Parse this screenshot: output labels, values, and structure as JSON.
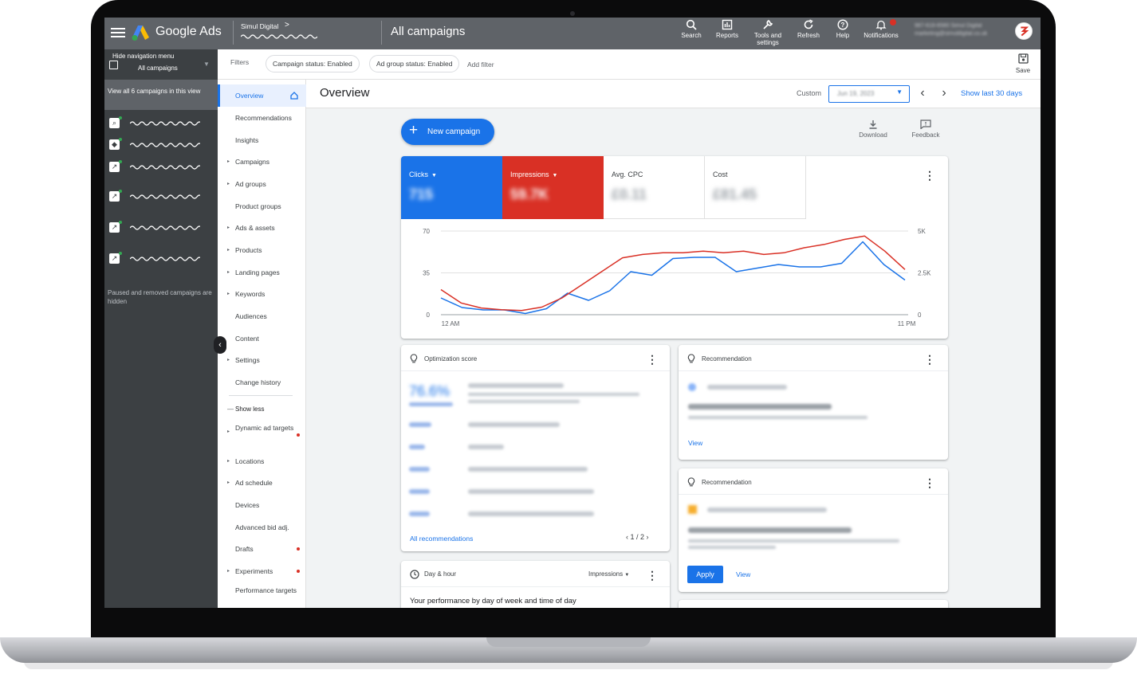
{
  "topbar": {
    "brand": "Google Ads",
    "account_name": "Simul Digital",
    "account_chevron": ">",
    "page_title": "All campaigns",
    "actions": [
      {
        "label": "Search",
        "icon": "search-icon"
      },
      {
        "label": "Reports",
        "icon": "reports-icon"
      },
      {
        "label": "Tools and settings",
        "icon": "wrench-icon"
      },
      {
        "label": "Refresh",
        "icon": "refresh-icon"
      },
      {
        "label": "Help",
        "icon": "help-icon"
      },
      {
        "label": "Notifications",
        "icon": "bell-icon"
      }
    ],
    "account_blurred_line1": "987-618-6580 Simul Digital",
    "account_blurred_line2": "marketing@simuldigital.co.uk"
  },
  "campaign_sidebar": {
    "hide_nav_label": "Hide navigation menu",
    "hide_nav_sub": "All campaigns",
    "view_all": "View all 6 campaigns in this view",
    "note": "Paused and removed campaigns are hidden"
  },
  "page_nav": {
    "items": [
      {
        "label": "Overview"
      },
      {
        "label": "Recommendations"
      },
      {
        "label": "Insights"
      },
      {
        "label": "Campaigns"
      },
      {
        "label": "Ad groups"
      },
      {
        "label": "Product groups"
      },
      {
        "label": "Ads & assets"
      },
      {
        "label": "Products"
      },
      {
        "label": "Landing pages"
      },
      {
        "label": "Keywords"
      },
      {
        "label": "Audiences"
      },
      {
        "label": "Content"
      },
      {
        "label": "Settings"
      },
      {
        "label": "Change history"
      }
    ],
    "show_less": "Show less",
    "more_items": [
      {
        "label": "Dynamic ad targets"
      },
      {
        "label": "Locations"
      },
      {
        "label": "Ad schedule"
      },
      {
        "label": "Devices"
      },
      {
        "label": "Advanced bid adj."
      },
      {
        "label": "Drafts"
      },
      {
        "label": "Experiments"
      },
      {
        "label": "Performance targets"
      }
    ]
  },
  "filters": {
    "label": "Filters",
    "chips": [
      "Campaign status: Enabled",
      "Ad group status: Enabled"
    ],
    "add_filter": "Add filter",
    "save": "Save"
  },
  "overview": {
    "title": "Overview",
    "custom_label": "Custom",
    "date_value": "Jun 19, 2023",
    "show_last": "Show last 30 days",
    "new_campaign": "New campaign",
    "download": "Download",
    "feedback": "Feedback"
  },
  "metrics": [
    {
      "label": "Clicks",
      "value": "715",
      "bg": "#1a73e8",
      "fg": "#ffffff"
    },
    {
      "label": "Impressions",
      "value": "59.7K",
      "bg": "#d93025",
      "fg": "#ffffff"
    },
    {
      "label": "Avg. CPC",
      "value": "£0.11",
      "bg": "#ffffff",
      "fg": "#3c4043"
    },
    {
      "label": "Cost",
      "value": "£81.45",
      "bg": "#ffffff",
      "fg": "#3c4043"
    }
  ],
  "chart_data": {
    "type": "line",
    "x_labels": [
      "12 AM",
      "11 PM"
    ],
    "left_ticks": [
      "70",
      "35",
      "0"
    ],
    "right_ticks": [
      "5K",
      "2.5K",
      "0"
    ],
    "ylim_left": [
      0,
      70
    ],
    "ylim_right": [
      0,
      5000
    ],
    "series": [
      {
        "name": "Clicks",
        "color": "#1a73e8",
        "axis": "left",
        "values": [
          14,
          6,
          4,
          4,
          1,
          5,
          18,
          12,
          20,
          36,
          33,
          47,
          48,
          48,
          36,
          39,
          42,
          40,
          40,
          43,
          61,
          42,
          29
        ]
      },
      {
        "name": "Impressions",
        "color": "#d93025",
        "axis": "right",
        "values": [
          1500,
          700,
          400,
          300,
          250,
          450,
          1000,
          1800,
          2600,
          3400,
          3600,
          3700,
          3700,
          3800,
          3700,
          3800,
          3600,
          3700,
          4000,
          4200,
          4500,
          4700,
          3800,
          2700
        ]
      }
    ]
  },
  "optimization": {
    "title": "Optimization score",
    "score": "76.6%",
    "all_recommendations": "All recommendations",
    "pager": "1 / 2"
  },
  "recommendation1": {
    "title": "Recommendation",
    "view": "View"
  },
  "recommendation2": {
    "title": "Recommendation",
    "apply": "Apply",
    "view": "View"
  },
  "day_hour": {
    "title": "Day & hour",
    "metric": "Impressions",
    "subtitle": "Your performance by day of week and time of day"
  },
  "colors": {
    "accent": "#1a73e8",
    "danger": "#d93025",
    "topbar": "#5f6368",
    "sidebar": "#3c4043"
  }
}
